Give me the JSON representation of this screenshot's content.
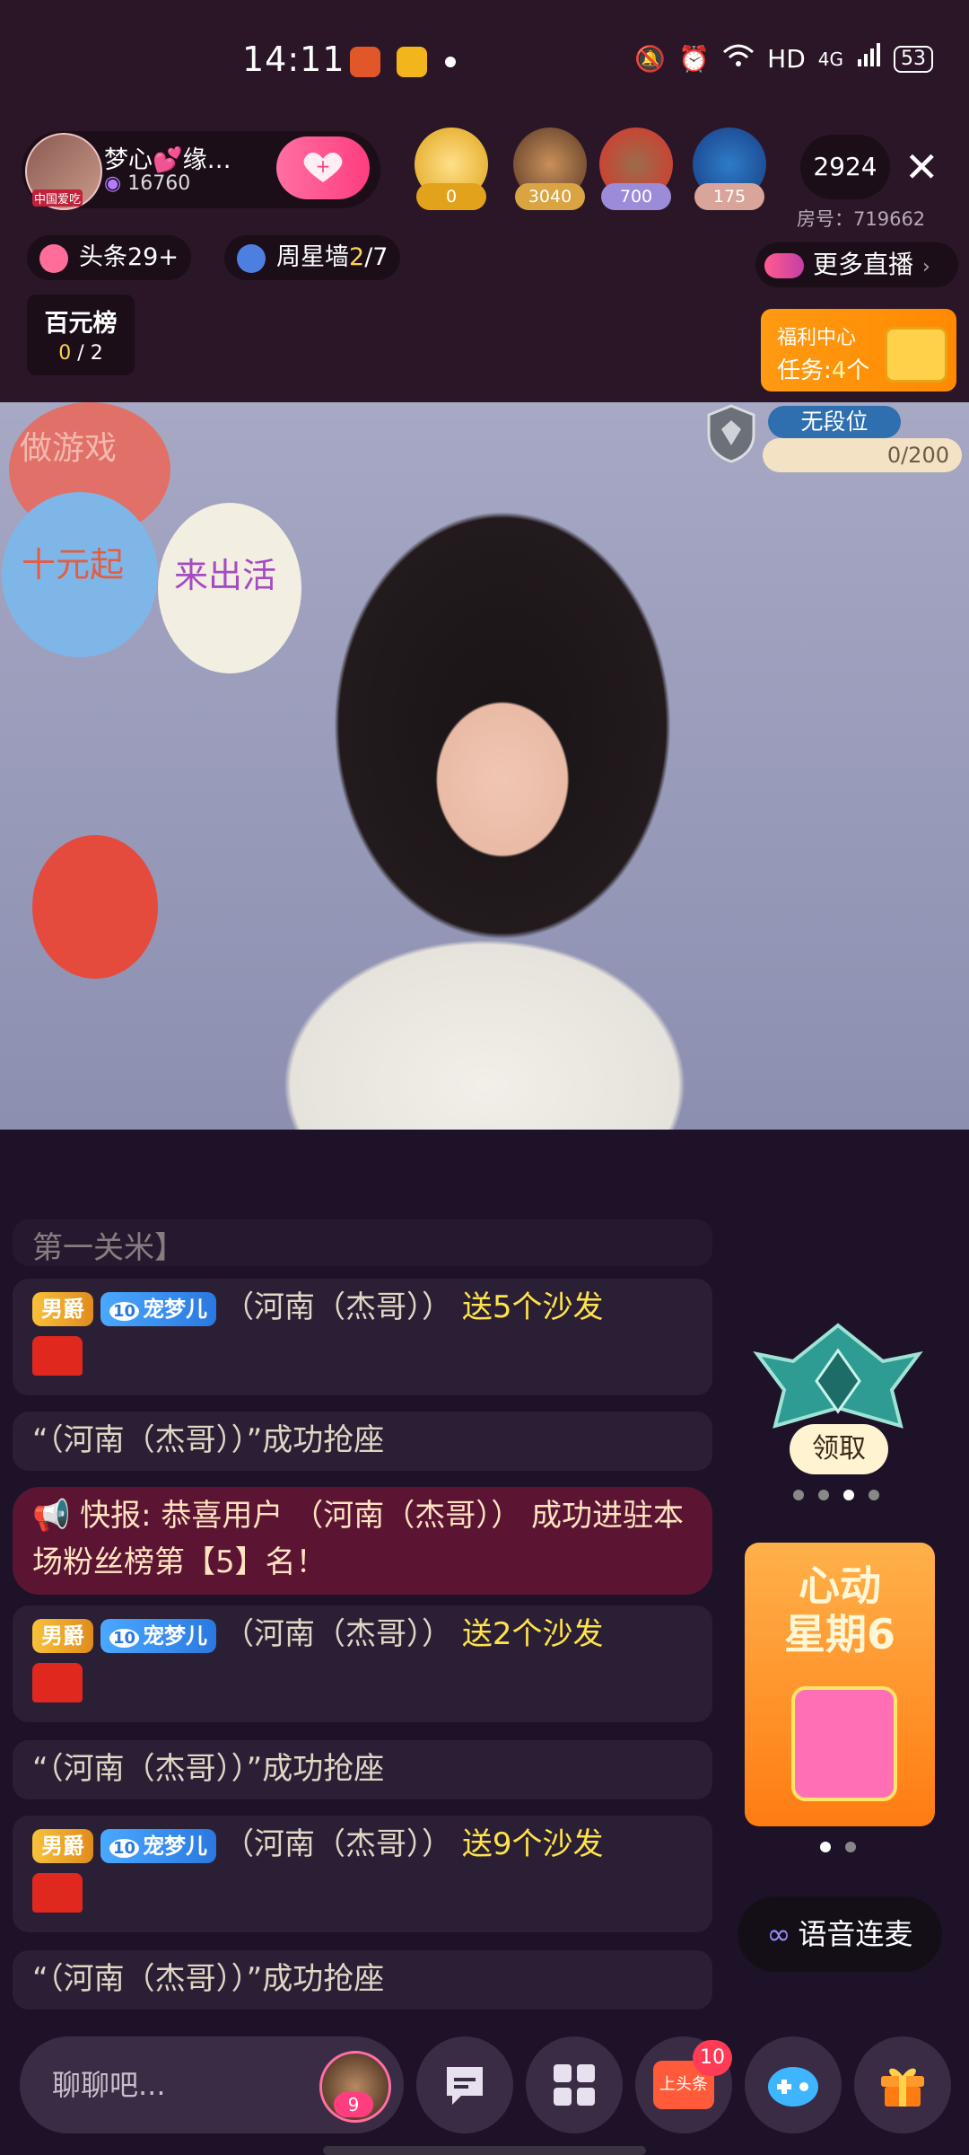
{
  "status_bar": {
    "time": "14:11",
    "network": "HD",
    "signal": "4G",
    "battery": "53"
  },
  "anchor": {
    "name": "梦心💕缘…",
    "fans_count": "16760",
    "avatar_label": "中国爱吃"
  },
  "top_ranks": [
    {
      "value": "0"
    },
    {
      "value": "3040"
    },
    {
      "value": "700"
    },
    {
      "value": "175"
    }
  ],
  "viewers": "2924",
  "room_number": "房号：719662",
  "tags": {
    "headline": "头条29+",
    "star_wall_prefix": "周星墙",
    "star_wall_current": "2",
    "star_wall_total": "/7"
  },
  "more_live": "更多直播",
  "board": {
    "title": "百元榜",
    "current": "0",
    "total": " / 2"
  },
  "welfare": {
    "title": "福利中心",
    "task_prefix": "任务:",
    "task_count": "4",
    "task_suffix": "个"
  },
  "video": {
    "balloon1": "做游戏",
    "balloon2": "十元起",
    "balloon3": "来出活"
  },
  "tier": {
    "label": "无段位",
    "progress": "0/200"
  },
  "chat": {
    "cut_line": "第一关米】",
    "messages": [
      {
        "type": "gift",
        "badge1": "男爵",
        "badge2_level": "10",
        "badge2": "宠梦儿",
        "user": "（河南（杰哥））",
        "action": "送5个沙发"
      },
      {
        "type": "seat",
        "text": "“（河南（杰哥））”成功抢座"
      },
      {
        "type": "notice",
        "text": "快报: 恭喜用户 （河南（杰哥）） 成功进驻本场粉丝榜第【5】名！"
      },
      {
        "type": "gift",
        "badge1": "男爵",
        "badge2_level": "10",
        "badge2": "宠梦儿",
        "user": "（河南（杰哥））",
        "action": "送2个沙发"
      },
      {
        "type": "seat",
        "text": "“（河南（杰哥））”成功抢座"
      },
      {
        "type": "gift",
        "badge1": "男爵",
        "badge2_level": "10",
        "badge2": "宠梦儿",
        "user": "（河南（杰哥））",
        "action": "送9个沙发"
      },
      {
        "type": "seat",
        "text": "“（河南（杰哥））”成功抢座"
      }
    ]
  },
  "claim_button": "领取",
  "promo": {
    "line1": "心动",
    "line2": "星期6"
  },
  "voice_connect": "语音连麦",
  "bottom": {
    "input_placeholder": "聊聊吧...",
    "avatar_count": "9",
    "headline_badge": "上头条",
    "notification_count": "10"
  },
  "colors": {
    "background": "#1e1229",
    "accent_pink": "#ff3d7f",
    "gift_yellow": "#ffe34a",
    "notice_bg": "#5b1533"
  }
}
